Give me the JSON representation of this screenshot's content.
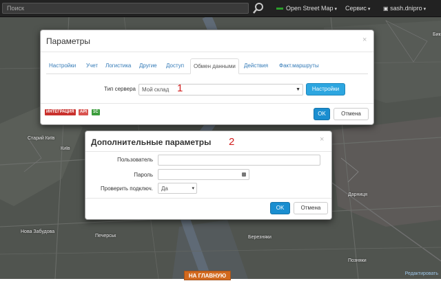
{
  "topbar": {
    "search_placeholder": "Поиск",
    "map_layer": "Open Street Map",
    "service_menu": "Сервис",
    "user_menu": "sash.dnipro"
  },
  "map_labels": {
    "stariy_kyiv": "Старий Київ",
    "kyiv": "Київ",
    "nova_zabudova": "Нова Забудова",
    "pechersk": "Печерськ",
    "darnytsia": "Дарниця",
    "berezniaky": "Березняки",
    "top_right": "Бик",
    "pozniaky": "Позняки"
  },
  "dialog1": {
    "title": "Параметры",
    "tabs": [
      "Настройки",
      "Учет",
      "Логистика",
      "Другие",
      "Доступ",
      "Обмен данными",
      "Действия",
      "Факт.маршруты"
    ],
    "active_tab": "Обмен данными",
    "server_type_label": "Тип сервера",
    "server_type_value": "Мой склад",
    "settings_button": "Настройки",
    "badges": [
      "ИНТЕГРАЦИЯ",
      "API",
      "1C"
    ],
    "ok": "OK",
    "cancel": "Отмена"
  },
  "dialog2": {
    "title": "Дополнительные параметры",
    "user_label": "Пользователь",
    "password_label": "Пароль",
    "check_label": "Проверить подключ.",
    "check_value": "Да",
    "ok": "OK",
    "cancel": "Отмена"
  },
  "annotations": {
    "one": "1",
    "two": "2"
  },
  "bottom": {
    "home_button": "НА ГЛАВНУЮ",
    "edit_link": "Редактировать"
  },
  "colors": {
    "accent": "#1a8ed0",
    "annotation": "#d21c1c",
    "badge_integration": "#c9302c",
    "badge_api": "#d9534f",
    "badge_1c": "#3c9d3c",
    "home_button": "#d2691e"
  }
}
